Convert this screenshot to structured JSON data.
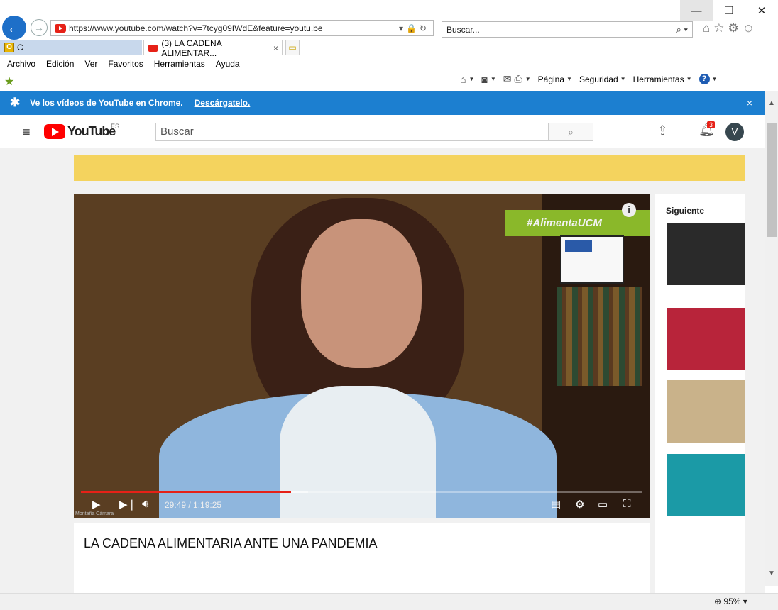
{
  "browser": {
    "address_url": "https://www.youtube.com/watch?v=7tcyg09IWdE&feature=youtu.be",
    "search_placeholder": "Buscar...",
    "tab_other_label": "C",
    "tab_active_label": "(3) LA CADENA ALIMENTAR...",
    "tab_close": "×",
    "zoom": "95%"
  },
  "menu": [
    "Archivo",
    "Edición",
    "Ver",
    "Favoritos",
    "Herramientas",
    "Ayuda"
  ],
  "command_bar": {
    "page_label": "Página",
    "security_label": "Seguridad",
    "tools_label": "Herramientas",
    "help_label": "?"
  },
  "chrome_banner": {
    "text": "Ve los vídeos de YouTube en Chrome.",
    "link": "Descárgatelo.",
    "close": "×"
  },
  "youtube": {
    "wordmark": "YouTube",
    "country": "ES",
    "search_placeholder": "Buscar",
    "notification_count": "3",
    "avatar_letter": "V"
  },
  "player": {
    "time_display": "29:49 / 1:19:25",
    "progress_fraction": 0.375,
    "buffered_fraction": 0.405,
    "overlay_text": "#AlimentaUCM",
    "watermark": "Montaña Cámara"
  },
  "video": {
    "title": "LA CADENA ALIMENTARIA ANTE UNA PANDEMIA"
  },
  "sidebar": {
    "heading": "Siguiente"
  },
  "icons": {
    "back": "back-arrow-icon",
    "forward": "forward-arrow-icon"
  },
  "colors": {
    "banner_blue": "#1c7fd0",
    "youtube_red": "#ff0000",
    "ad_yellow": "#f4d35e",
    "overlay_green": "#8ab82a"
  }
}
